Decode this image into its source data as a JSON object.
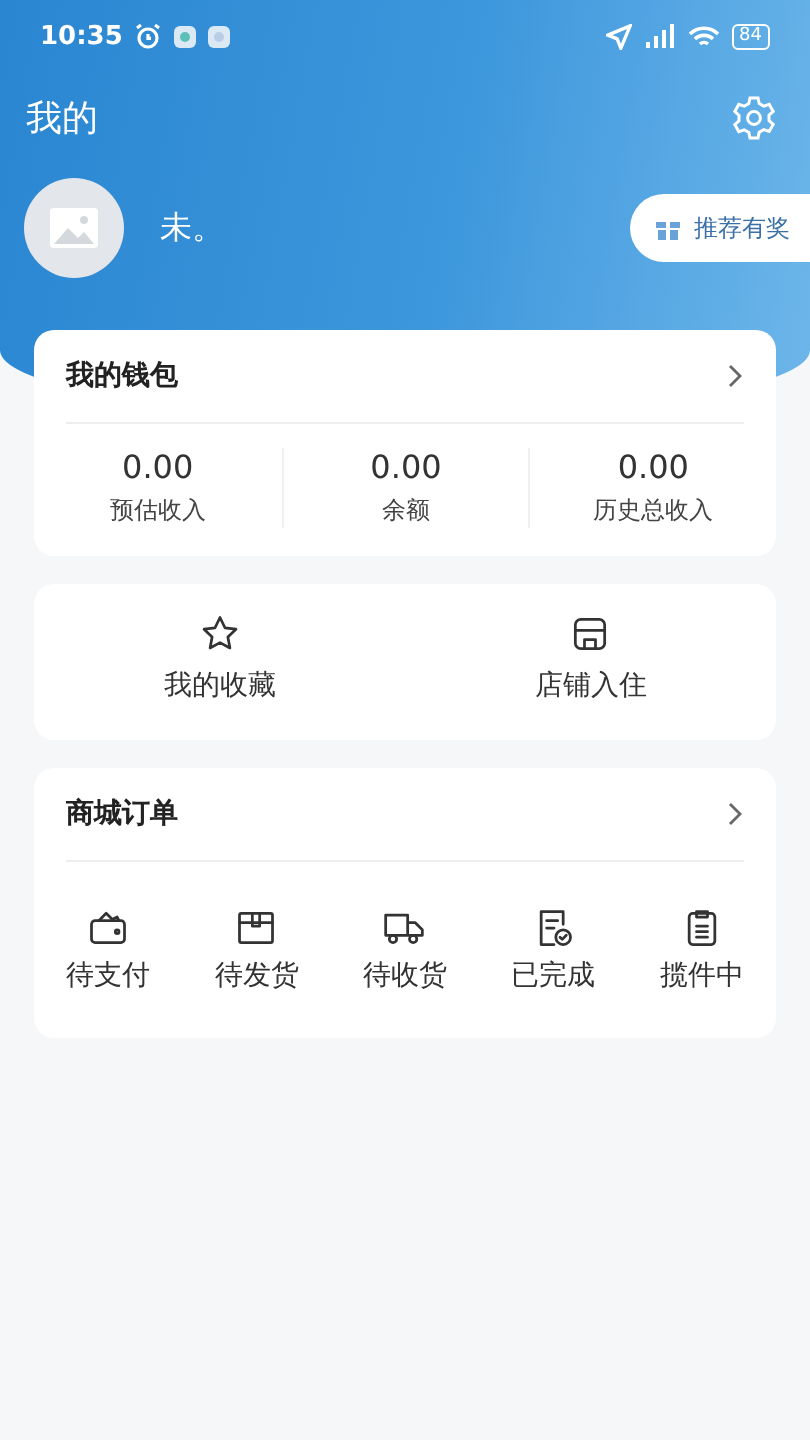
{
  "status_bar": {
    "time": "10:35",
    "battery": "84"
  },
  "header": {
    "title": "我的"
  },
  "profile": {
    "name": "未。",
    "referral": "推荐有奖"
  },
  "wallet": {
    "title": "我的钱包",
    "stats": [
      {
        "value": "0.00",
        "label": "预估收入"
      },
      {
        "value": "0.00",
        "label": "余额"
      },
      {
        "value": "0.00",
        "label": "历史总收入"
      }
    ]
  },
  "shortcuts": [
    {
      "kind": "star",
      "label": "我的收藏"
    },
    {
      "kind": "store",
      "label": "店铺入住"
    }
  ],
  "orders": {
    "title": "商城订单",
    "items": [
      {
        "kind": "wallet",
        "label": "待支付"
      },
      {
        "kind": "box",
        "label": "待发货"
      },
      {
        "kind": "truck",
        "label": "待收货"
      },
      {
        "kind": "done",
        "label": "已完成"
      },
      {
        "kind": "clipboard",
        "label": "揽件中"
      }
    ]
  }
}
